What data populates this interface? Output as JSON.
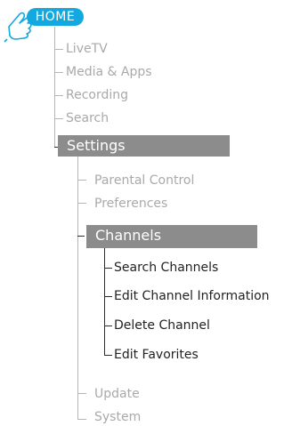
{
  "home": {
    "label": "HOME"
  },
  "menu": {
    "level1": [
      {
        "label": "LiveTV"
      },
      {
        "label": "Media & Apps"
      },
      {
        "label": "Recording"
      },
      {
        "label": "Search"
      }
    ],
    "settings": {
      "label": "Settings",
      "level2_top": [
        {
          "label": "Parental Control"
        },
        {
          "label": "Preferences"
        }
      ],
      "channels": {
        "label": "Channels",
        "items": [
          {
            "label": "Search Channels"
          },
          {
            "label": "Edit Channel Information"
          },
          {
            "label": "Delete Channel"
          },
          {
            "label": "Edit Favorites"
          }
        ]
      },
      "level2_bottom": [
        {
          "label": "Update"
        },
        {
          "label": "System"
        }
      ]
    }
  },
  "colors": {
    "home_badge": "#12a9e0",
    "selected_bar": "#8c8c8c",
    "inactive_text": "#a9a9a9",
    "active_text": "#222222"
  },
  "icons": {
    "pointer": "hand-pointer-icon"
  }
}
